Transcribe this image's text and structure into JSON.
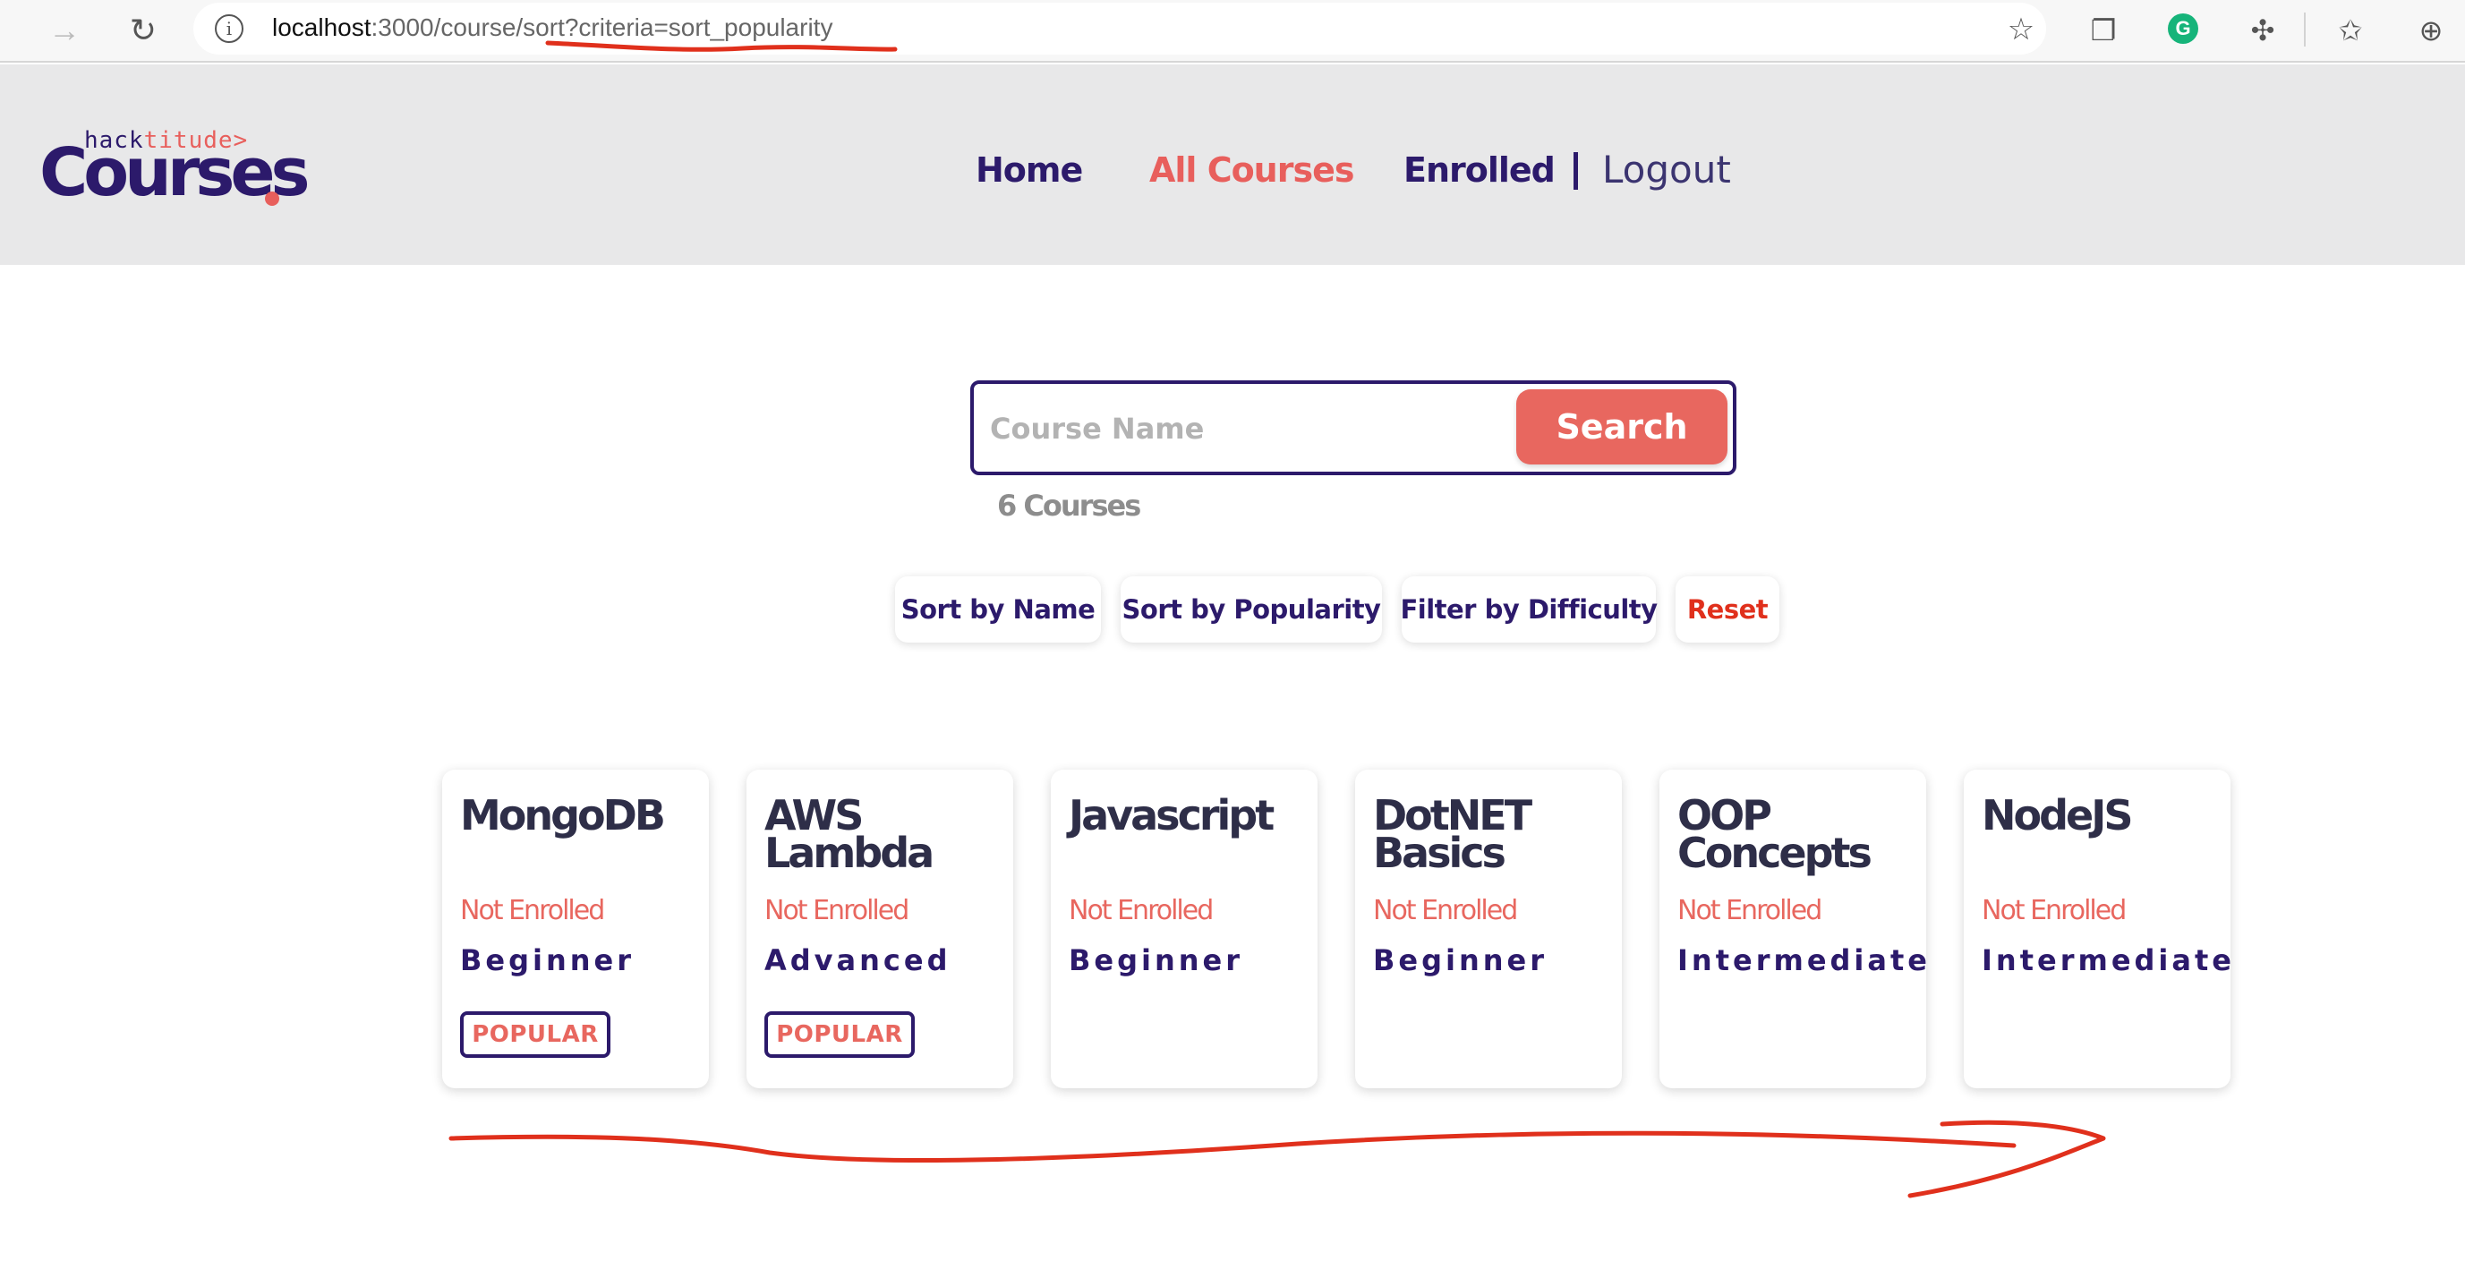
{
  "browser": {
    "url_host": "localhost",
    "url_rest": ":3000/course/sort?criteria=sort_popularity"
  },
  "header": {
    "logo_top_left": "hack",
    "logo_top_right": "titude>",
    "logo_main": "Courses",
    "nav": {
      "home": "Home",
      "all_courses": "All Courses",
      "enrolled": "Enrolled",
      "logout": "Logout"
    }
  },
  "search": {
    "placeholder": "Course Name",
    "button": "Search",
    "count": "6 Courses"
  },
  "controls": {
    "sort_name": "Sort by Name",
    "sort_popularity": "Sort by Popularity",
    "filter_difficulty": "Filter by Difficulty",
    "reset": "Reset"
  },
  "courses": [
    {
      "title": "MongoDB",
      "status": "Not Enrolled",
      "level": "Beginner",
      "badge": "POPULAR"
    },
    {
      "title": "AWS Lambda",
      "status": "Not Enrolled",
      "level": "Advanced",
      "badge": "POPULAR"
    },
    {
      "title": "Javascript",
      "status": "Not Enrolled",
      "level": "Beginner",
      "badge": ""
    },
    {
      "title": "DotNET Basics",
      "status": "Not Enrolled",
      "level": "Beginner",
      "badge": ""
    },
    {
      "title": "OOP Concepts",
      "status": "Not Enrolled",
      "level": "Intermediate",
      "badge": ""
    },
    {
      "title": "NodeJS",
      "status": "Not Enrolled",
      "level": "Intermediate",
      "badge": ""
    }
  ],
  "colors": {
    "primary": "#2c1a6b",
    "accent": "#e8675f",
    "annotation": "#e0301c"
  }
}
